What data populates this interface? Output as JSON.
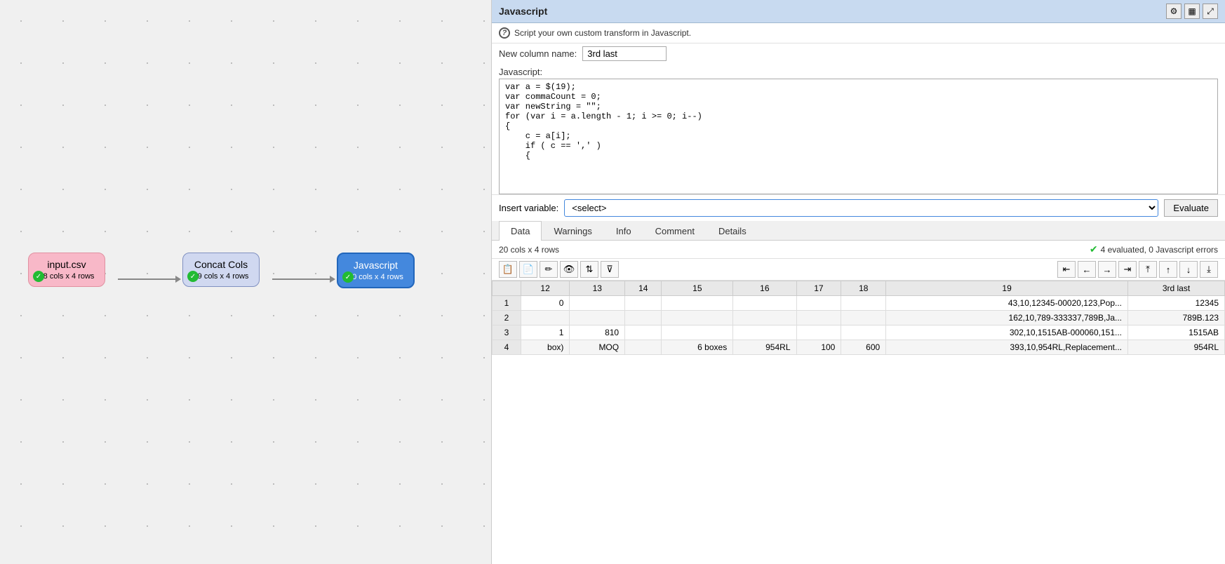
{
  "canvas": {
    "nodes": [
      {
        "id": "input-csv",
        "label": "input.csv",
        "subtitle": "18 cols x 4 rows",
        "type": "input",
        "checked": true
      },
      {
        "id": "concat-cols",
        "label": "Concat Cols",
        "subtitle": "19 cols x 4 rows",
        "type": "concat",
        "checked": true
      },
      {
        "id": "javascript",
        "label": "Javascript",
        "subtitle": "20 cols x 4 rows",
        "type": "js",
        "checked": true
      }
    ]
  },
  "panel": {
    "title": "Javascript",
    "info_text": "Script your own custom transform in Javascript.",
    "new_column_label": "New column name:",
    "new_column_value": "3rd last",
    "javascript_label": "Javascript:",
    "code": "var a = $(19);\nvar commaCount = 0;\nvar newString = \"\";\nfor (var i = a.length - 1; i >= 0; i--)\n{\n    c = a[i];\n    if ( c == ',' )\n    {",
    "insert_variable_label": "Insert variable:",
    "insert_variable_placeholder": "<select>",
    "evaluate_label": "Evaluate",
    "tabs": [
      "Data",
      "Warnings",
      "Info",
      "Comment",
      "Details"
    ],
    "active_tab": "Data",
    "data_status": "20 cols x 4 rows",
    "eval_status": "4 evaluated, 0 Javascript errors",
    "table": {
      "columns": [
        "",
        "12",
        "13",
        "14",
        "15",
        "16",
        "17",
        "18",
        "19",
        "3rd last"
      ],
      "rows": [
        [
          "1",
          "0",
          "",
          "",
          "",
          "",
          "",
          "",
          "43,10,12345-00020,123,Pop...",
          "12345"
        ],
        [
          "2",
          "",
          "",
          "",
          "",
          "",
          "",
          "",
          "162,10,789-333337,789B,Ja...",
          "789B.123"
        ],
        [
          "3",
          "1",
          "810",
          "",
          "",
          "",
          "",
          "",
          "302,10,1515AB-000060,151...",
          "1515AB"
        ],
        [
          "4",
          "box)",
          "MOQ",
          "",
          "6 boxes",
          "954RL",
          "100",
          "600",
          "393,10,954RL,Replacement...",
          "954RL"
        ]
      ]
    }
  }
}
